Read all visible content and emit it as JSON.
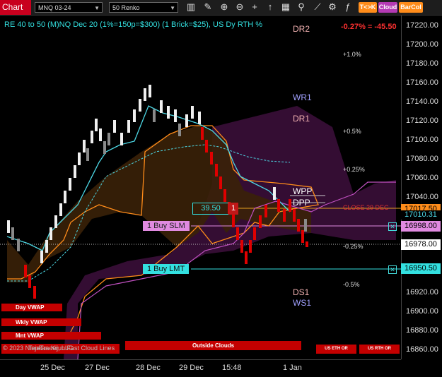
{
  "toolbar": {
    "title": "Chart",
    "instrument": "MNQ 03-24",
    "bar_type": "50 Renko",
    "buttons": [
      "T<>K",
      "Cloud",
      "BarCol"
    ],
    "colors": {
      "tk": "#ff8c1a",
      "cloud": "#b43ab4",
      "barcol": "#ff8c1a"
    }
  },
  "chart": {
    "description": "RE 40 to 50 (M)NQ Dec 20 (1%=150p=$300) (1 Brick=$25), US Dy RTH %",
    "change": "-0.27% = -45.50",
    "copyright": "© 2023 NinjaTrader, LLC",
    "watermark": "Tenkan-Kijun Fast Cloud Lines",
    "pct_labels": [
      "+1.0%",
      "+0.5%",
      "+0.25%",
      "-0.25%",
      "-0.5%"
    ],
    "pivots": [
      "DR2",
      "WR1",
      "DR1",
      "WPP",
      "DPP",
      "DS1",
      "WS1"
    ],
    "close_label": "CLOSE 29 DEC",
    "price_box": "39.50",
    "qty_box": "1",
    "orders": [
      {
        "label": "1 Buy SLM",
        "price": "16998.00"
      },
      {
        "label": "1 Buy LMT",
        "price": "16950.50"
      }
    ],
    "vwap_labels": [
      "Day VWAP",
      "Wkly VWAP",
      "Mnt VWAP"
    ],
    "session_labels": [
      "Outside Clouds",
      "US ETH OR",
      "US RTH OR"
    ]
  },
  "y_axis": {
    "ticks": [
      "17220.00",
      "17200.00",
      "17180.00",
      "17160.00",
      "17140.00",
      "17120.00",
      "17100.00",
      "17080.00",
      "17060.00",
      "17040.00",
      "16920.00",
      "16900.00",
      "16880.00",
      "16860.00"
    ],
    "flags": [
      {
        "value": "17017.50",
        "color": "#ff8c1a"
      },
      {
        "value": "17010.31",
        "color": "#4dd9e6"
      },
      {
        "value": "16998.00",
        "color": "#e08ae0"
      },
      {
        "value": "16978.00",
        "color": "#ffffff"
      },
      {
        "value": "16950.50",
        "color": "#33e0e0"
      }
    ]
  },
  "x_axis": {
    "ticks": [
      "25 Dec",
      "27 Dec",
      "28 Dec",
      "29 Dec",
      "15:48",
      "1 Jan"
    ]
  }
}
